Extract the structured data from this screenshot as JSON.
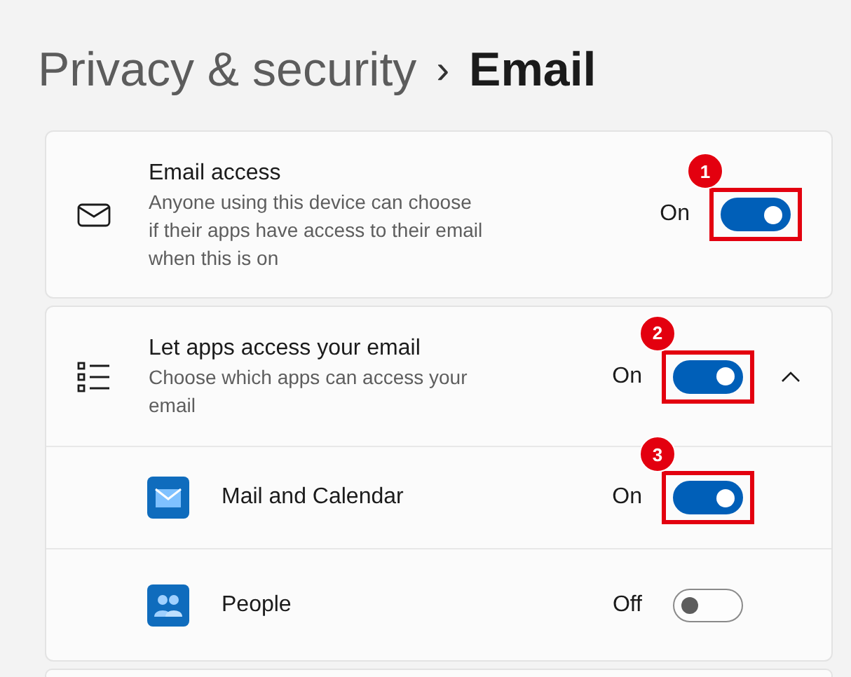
{
  "breadcrumb": {
    "parent": "Privacy & security",
    "separator": "›",
    "current": "Email"
  },
  "sections": [
    {
      "kind": "setting",
      "title": "Email access",
      "description": "Anyone using this device can choose if their apps have access to their email when this is on",
      "state_label": "On",
      "on": true,
      "annotation": "1"
    },
    {
      "kind": "group",
      "title": "Let apps access your email",
      "description": "Choose which apps can access your email",
      "state_label": "On",
      "on": true,
      "annotation": "2",
      "expanded": true,
      "apps": [
        {
          "name": "Mail and Calendar",
          "state_label": "On",
          "on": true,
          "annotation": "3"
        },
        {
          "name": "People",
          "state_label": "Off",
          "on": false
        }
      ]
    },
    {
      "kind": "blank"
    }
  ]
}
